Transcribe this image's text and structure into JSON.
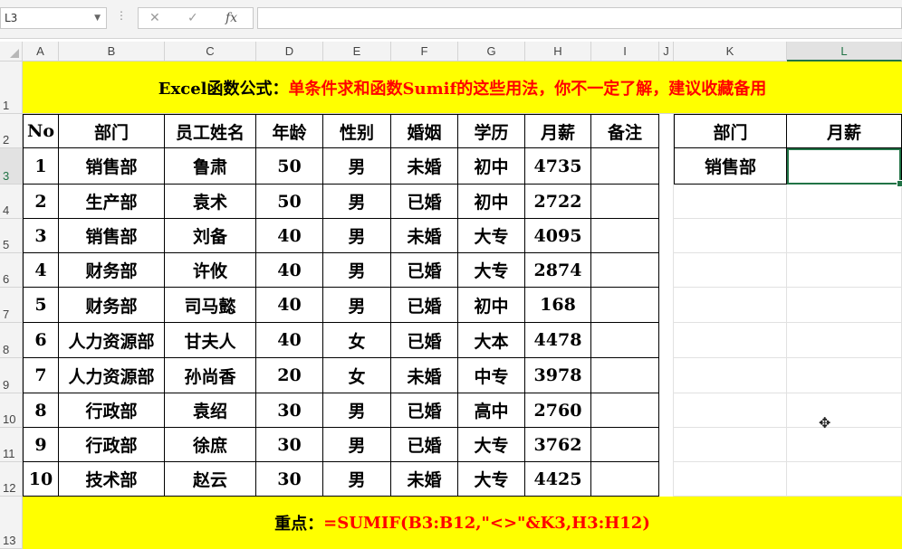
{
  "namebox": {
    "value": "L3"
  },
  "formula_bar": {
    "cancel_icon": "✕",
    "enter_icon": "✓",
    "fx_label": "fx",
    "value": ""
  },
  "columns": [
    "A",
    "B",
    "C",
    "D",
    "E",
    "F",
    "G",
    "H",
    "I",
    "J",
    "K",
    "L"
  ],
  "rows": [
    "1",
    "2",
    "3",
    "4",
    "5",
    "6",
    "7",
    "8",
    "9",
    "10",
    "11",
    "12",
    "13"
  ],
  "title": {
    "black": "Excel函数公式：",
    "red": "单条件求和函数Sumif的这些用法，你不一定了解，建议收藏备用"
  },
  "table": {
    "headers": [
      "No",
      "部门",
      "员工姓名",
      "年龄",
      "性别",
      "婚姻",
      "学历",
      "月薪",
      "备注"
    ],
    "rows": [
      [
        "1",
        "销售部",
        "鲁肃",
        "50",
        "男",
        "未婚",
        "初中",
        "4735",
        ""
      ],
      [
        "2",
        "生产部",
        "袁术",
        "50",
        "男",
        "已婚",
        "初中",
        "2722",
        ""
      ],
      [
        "3",
        "销售部",
        "刘备",
        "40",
        "男",
        "未婚",
        "大专",
        "4095",
        ""
      ],
      [
        "4",
        "财务部",
        "许攸",
        "40",
        "男",
        "已婚",
        "大专",
        "2874",
        ""
      ],
      [
        "5",
        "财务部",
        "司马懿",
        "40",
        "男",
        "已婚",
        "初中",
        "168",
        ""
      ],
      [
        "6",
        "人力资源部",
        "甘夫人",
        "40",
        "女",
        "已婚",
        "大本",
        "4478",
        ""
      ],
      [
        "7",
        "人力资源部",
        "孙尚香",
        "20",
        "女",
        "未婚",
        "中专",
        "3978",
        ""
      ],
      [
        "8",
        "行政部",
        "袁绍",
        "30",
        "男",
        "已婚",
        "高中",
        "2760",
        ""
      ],
      [
        "9",
        "行政部",
        "徐庶",
        "30",
        "男",
        "已婚",
        "大专",
        "3762",
        ""
      ],
      [
        "10",
        "技术部",
        "赵云",
        "30",
        "男",
        "未婚",
        "大专",
        "4425",
        ""
      ]
    ]
  },
  "lookup": {
    "headers": [
      "部门",
      "月薪"
    ],
    "department": "销售部",
    "result": ""
  },
  "footer": {
    "black": "重点：",
    "red": "=SUMIF(B3:B12,\"<>\"&K3,H3:H12)"
  },
  "colors": {
    "banner": "#ffff00",
    "red_text": "#ff0000",
    "selection": "#217346"
  },
  "cursor_icon": "✥"
}
